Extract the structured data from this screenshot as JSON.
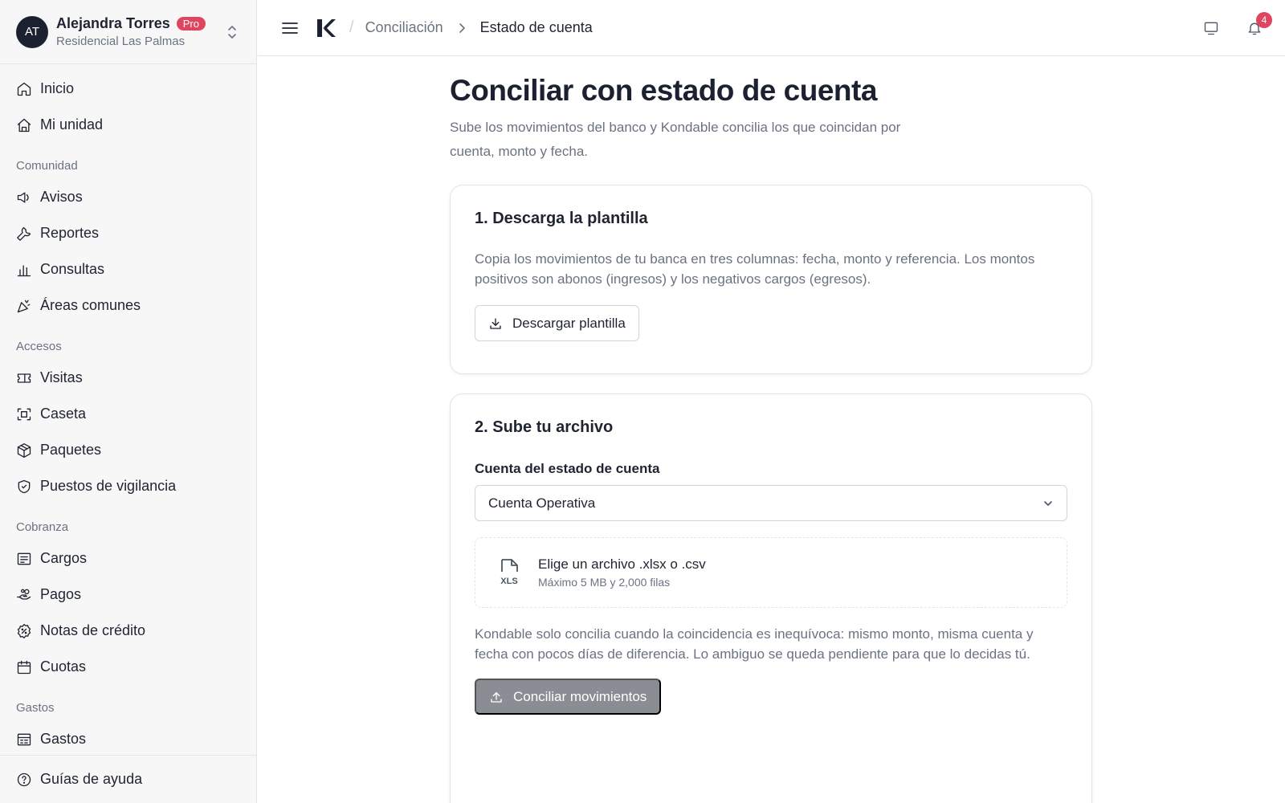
{
  "user": {
    "initials": "AT",
    "name": "Alejandra Torres",
    "badge": "Pro",
    "community": "Residencial Las Palmas"
  },
  "sidebar": {
    "top_items": [
      {
        "label": "Inicio",
        "icon": "home-icon"
      },
      {
        "label": "Mi unidad",
        "icon": "house-icon"
      }
    ],
    "sections": [
      {
        "title": "Comunidad",
        "items": [
          {
            "label": "Avisos",
            "icon": "megaphone-icon"
          },
          {
            "label": "Reportes",
            "icon": "wrench-icon"
          },
          {
            "label": "Consultas",
            "icon": "bar-chart-icon"
          },
          {
            "label": "Áreas comunes",
            "icon": "party-popper-icon"
          }
        ]
      },
      {
        "title": "Accesos",
        "items": [
          {
            "label": "Visitas",
            "icon": "ticket-icon"
          },
          {
            "label": "Caseta",
            "icon": "scan-icon"
          },
          {
            "label": "Paquetes",
            "icon": "package-icon"
          },
          {
            "label": "Puestos de vigilancia",
            "icon": "shield-check-icon"
          }
        ]
      },
      {
        "title": "Cobranza",
        "items": [
          {
            "label": "Cargos",
            "icon": "receipt-icon"
          },
          {
            "label": "Pagos",
            "icon": "hand-coins-icon"
          },
          {
            "label": "Notas de crédito",
            "icon": "badge-percent-icon"
          },
          {
            "label": "Cuotas",
            "icon": "calendar-icon"
          }
        ]
      },
      {
        "title": "Gastos",
        "items": [
          {
            "label": "Gastos",
            "icon": "expense-list-icon"
          }
        ]
      }
    ],
    "help_label": "Guías de ayuda"
  },
  "breadcrumb": {
    "parent": "Conciliación",
    "current": "Estado de cuenta"
  },
  "notifications": {
    "count": "4"
  },
  "page": {
    "title": "Conciliar con estado de cuenta",
    "description": "Sube los movimientos del banco y Kondable concilia los que coincidan por cuenta, monto y fecha."
  },
  "step1": {
    "title": "1. Descarga la plantilla",
    "text": "Copia los movimientos de tu banca en tres columnas: fecha, monto y referencia. Los montos positivos son abonos (ingresos) y los negativos cargos (egresos).",
    "button_label": "Descargar plantilla"
  },
  "step2": {
    "title": "2. Sube tu archivo",
    "account_label": "Cuenta del estado de cuenta",
    "account_value": "Cuenta Operativa",
    "file_icon_text": "XLS",
    "dropzone_title": "Elige un archivo .xlsx o .csv",
    "dropzone_sub": "Máximo 5 MB y 2,000 filas",
    "note": "Kondable solo concilia cuando la coincidencia es inequívoca: mismo monto, misma cuenta y fecha con pocos días de diferencia. Lo ambiguo se queda pendiente para que lo decidas tú.",
    "submit_label": "Conciliar movimientos"
  },
  "colors": {
    "accent": "#e0455f",
    "sidebar_bg": "#f7f7f8",
    "text_dark": "#1f2430",
    "text_muted": "#6b7280",
    "disabled_button": "#8a8d93"
  }
}
